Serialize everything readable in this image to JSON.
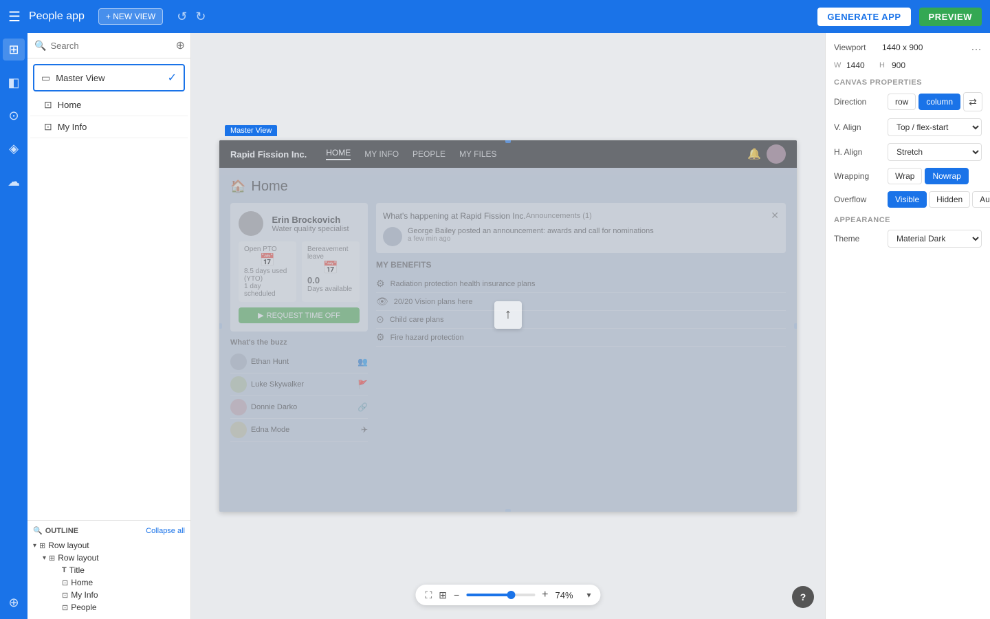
{
  "topBar": {
    "menuIcon": "☰",
    "appTitle": "People app",
    "newViewLabel": "+ NEW VIEW",
    "generateLabel": "GENERATE APP",
    "previewLabel": "PREVIEW"
  },
  "leftPanel": {
    "searchPlaceholder": "Search",
    "views": [
      {
        "label": "Master View",
        "active": true
      },
      {
        "label": "Home"
      },
      {
        "label": "My Info"
      }
    ]
  },
  "outline": {
    "title": "OUTLINE",
    "collapseLabel": "Collapse all",
    "items": [
      {
        "label": "Row layout",
        "indent": 0,
        "icon": "⊞",
        "type": "row",
        "expanded": true
      },
      {
        "label": "Row layout",
        "indent": 1,
        "icon": "⊞",
        "type": "row",
        "expanded": true
      },
      {
        "label": "Title",
        "indent": 2,
        "icon": "T",
        "type": "text"
      },
      {
        "label": "Home",
        "indent": 2,
        "icon": "⊡",
        "type": "nav"
      },
      {
        "label": "My Info",
        "indent": 2,
        "icon": "⊡",
        "type": "nav"
      },
      {
        "label": "People",
        "indent": 2,
        "icon": "⊡",
        "type": "nav"
      }
    ]
  },
  "canvas": {
    "masterViewTag": "Master View",
    "zoomValue": "74%",
    "zoomMinus": "−",
    "zoomPlus": "+",
    "zoomChevron": "▾"
  },
  "previewApp": {
    "brand": "Rapid Fission Inc.",
    "navLinks": [
      "HOME",
      "MY INFO",
      "PEOPLE",
      "MY FILES"
    ],
    "activeNav": "HOME",
    "pageTitle": "Home",
    "profile": {
      "name": "Erin Brockovich",
      "role": "Water quality specialist"
    },
    "pto": {
      "openPto": "Open PTO",
      "bereavement": "Bereavement leave",
      "daysUsed": "8.5 days used (YTO)",
      "daysScheduled": "1 day scheduled",
      "daysAvailable": "Days available",
      "daysValue": "0.0",
      "requestBtn": "REQUEST TIME OFF"
    },
    "buzz": {
      "title": "What's the buzz",
      "items": [
        {
          "name": "Ethan Hunt"
        },
        {
          "name": "Luke Skywalker"
        },
        {
          "name": "Donnie Darko"
        },
        {
          "name": "Edna Mode"
        }
      ]
    },
    "announcements": {
      "title": "What's happening at Rapid Fission Inc.",
      "badge": "Announcements (1)",
      "item": {
        "text": "George Bailey posted an announcement: awards and call for nominations",
        "time": "a few min ago"
      }
    },
    "benefits": {
      "title": "MY BENEFITS",
      "items": [
        {
          "label": "Radiation protection health insurance plans",
          "sub": ""
        },
        {
          "label": "20/20 Vision plans here",
          "sub": ""
        },
        {
          "label": "Child care plans",
          "sub": ""
        },
        {
          "label": "Fire hazard protection",
          "sub": ""
        }
      ]
    }
  },
  "rightPanel": {
    "viewportLabel": "Viewport",
    "viewportValue": "1440 x 900",
    "wLabel": "W",
    "wValue": "1440",
    "hLabel": "H",
    "hValue": "900",
    "canvasPropertiesTitle": "CANVAS PROPERTIES",
    "directionLabel": "Direction",
    "rowBtn": "row",
    "columnBtn": "column",
    "vAlignLabel": "V. Align",
    "vAlignValue": "Top / flex-start",
    "hAlignLabel": "H. Align",
    "hAlignValue": "Stretch",
    "wrappingLabel": "Wrapping",
    "wrapBtn": "Wrap",
    "nowrapBtn": "Nowrap",
    "overflowLabel": "Overflow",
    "visibleBtn": "Visible",
    "hiddenBtn": "Hidden",
    "autoBtn": "Auto",
    "appearanceTitle": "APPEARANCE",
    "themeLabel": "Theme",
    "themeValue": "Material Dark"
  }
}
